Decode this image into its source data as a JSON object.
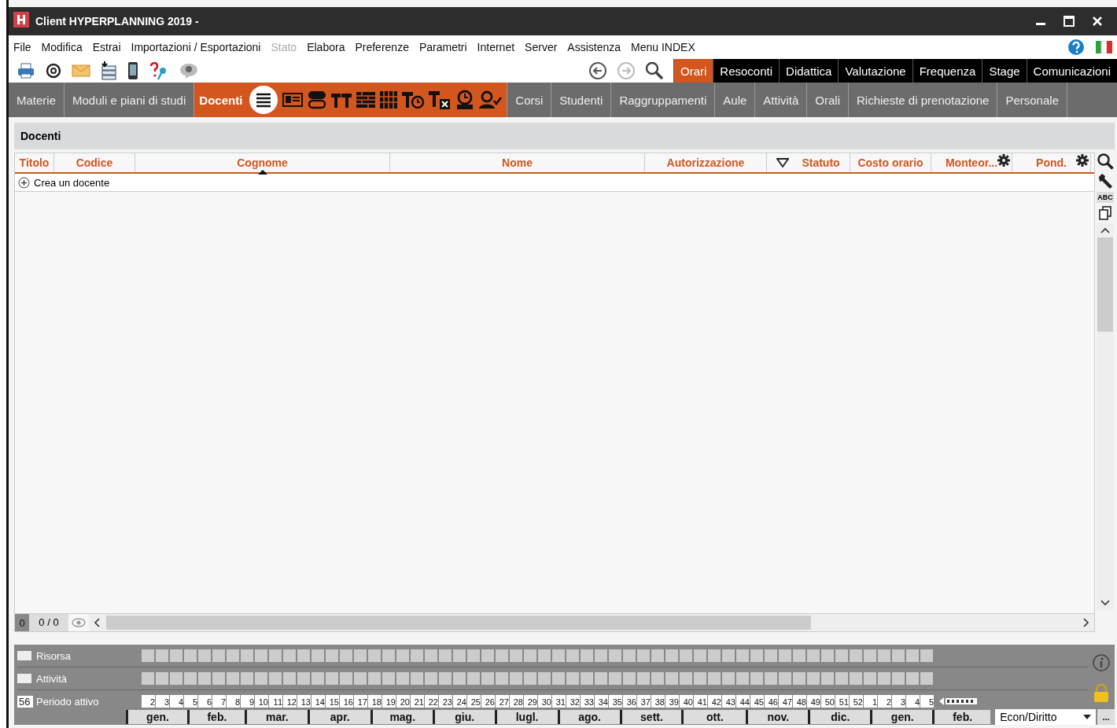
{
  "window": {
    "title": "Client HYPERPLANNING 2019 -"
  },
  "menu": [
    {
      "label": "File",
      "disabled": false
    },
    {
      "label": "Modifica",
      "disabled": false
    },
    {
      "label": "Estrai",
      "disabled": false
    },
    {
      "label": "Importazioni / Esportazioni",
      "disabled": false
    },
    {
      "label": "Stato",
      "disabled": true
    },
    {
      "label": "Elabora",
      "disabled": false
    },
    {
      "label": "Preferenze",
      "disabled": false
    },
    {
      "label": "Parametri",
      "disabled": false
    },
    {
      "label": "Internet",
      "disabled": false
    },
    {
      "label": "Server",
      "disabled": false
    },
    {
      "label": "Assistenza",
      "disabled": false
    },
    {
      "label": "Menu INDEX",
      "disabled": false
    }
  ],
  "section_tabs": [
    {
      "label": "Orari",
      "selected": true
    },
    {
      "label": "Resoconti",
      "selected": false
    },
    {
      "label": "Didattica",
      "selected": false
    },
    {
      "label": "Valutazione",
      "selected": false
    },
    {
      "label": "Frequenza",
      "selected": false
    },
    {
      "label": "Stage",
      "selected": false
    },
    {
      "label": "Comunicazioni",
      "selected": false
    }
  ],
  "module_tabs": [
    {
      "label": "Materie",
      "selected": false
    },
    {
      "label": "Moduli e piani di studi",
      "selected": false
    },
    {
      "label": "Docenti",
      "selected": true
    },
    {
      "label": "Corsi",
      "selected": false
    },
    {
      "label": "Studenti",
      "selected": false
    },
    {
      "label": "Raggruppamenti",
      "selected": false
    },
    {
      "label": "Aule",
      "selected": false
    },
    {
      "label": "Attività",
      "selected": false
    },
    {
      "label": "Orali",
      "selected": false
    },
    {
      "label": "Richieste di prenotazione",
      "selected": false
    },
    {
      "label": "Personale",
      "selected": false
    }
  ],
  "panel": {
    "title": "Docenti"
  },
  "table": {
    "columns": [
      {
        "label": "Titolo",
        "sorted": false,
        "filter": false,
        "settings": false
      },
      {
        "label": "Codice",
        "sorted": false,
        "filter": false,
        "settings": false
      },
      {
        "label": "Cognome",
        "sorted": true,
        "filter": false,
        "settings": false
      },
      {
        "label": "Nome",
        "sorted": false,
        "filter": false,
        "settings": false
      },
      {
        "label": "Autorizzazione",
        "sorted": false,
        "filter": false,
        "settings": false
      },
      {
        "label": "Statuto",
        "sorted": false,
        "filter": true,
        "settings": false
      },
      {
        "label": "Costo orario",
        "sorted": false,
        "filter": false,
        "settings": false
      },
      {
        "label": "Monteor...",
        "sorted": false,
        "filter": false,
        "settings": true
      },
      {
        "label": "Pond.",
        "sorted": false,
        "filter": false,
        "settings": true
      }
    ],
    "create_row": "Crea un docente",
    "side_tool_text": "ABC"
  },
  "footer": {
    "selected_count": "0",
    "total": "0 / 0"
  },
  "timeline": {
    "rows": [
      {
        "label": "Risorsa"
      },
      {
        "label": "Attività"
      }
    ],
    "period": {
      "count": "56",
      "label": "Periodo attivo"
    },
    "weeks": [
      "2",
      "3",
      "4",
      "5",
      "6",
      "7",
      "8",
      "9",
      "10",
      "11",
      "12",
      "13",
      "14",
      "15",
      "16",
      "17",
      "18",
      "19",
      "20",
      "21",
      "22",
      "23",
      "24",
      "25",
      "26",
      "27",
      "28",
      "29",
      "30",
      "31",
      "32",
      "33",
      "34",
      "35",
      "36",
      "37",
      "38",
      "39",
      "40",
      "41",
      "42",
      "43",
      "44",
      "45",
      "46",
      "47",
      "48",
      "49",
      "50",
      "51",
      "52",
      "1",
      "2",
      "3",
      "4",
      "5"
    ],
    "months": [
      "gen.",
      "feb.",
      "mar.",
      "apr.",
      "mag.",
      "giu.",
      "lugl.",
      "ago.",
      "sett.",
      "ott.",
      "nov.",
      "dic.",
      "gen.",
      "feb."
    ],
    "dropdown": "Econ/Diritto",
    "more_button": "..."
  }
}
